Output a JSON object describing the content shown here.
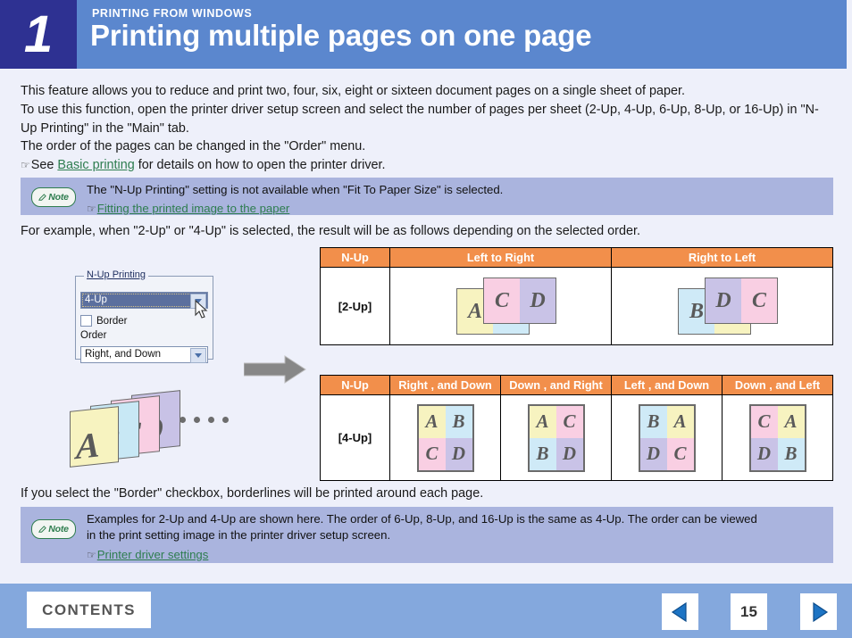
{
  "header": {
    "chapter_number": "1",
    "kicker": "PRINTING FROM WINDOWS",
    "title": "Printing multiple pages on one page",
    "number_bg": "#2e3192",
    "band_bg": "#5b87ce"
  },
  "intro": {
    "line1": "This feature allows you to reduce and print two, four, six, eight or sixteen document pages on a single sheet of paper.",
    "line2": "To use this function, open the printer driver setup screen and select the number of pages per sheet (2-Up, 4-Up, 6-Up, 8-Up, or 16-Up) in \"N-Up Printing\" in the \"Main\" tab.",
    "line3": "The order of the pages can be changed in the \"Order\" menu.",
    "line4_prefix": "See ",
    "line4_link": "Basic printing",
    "line4_suffix": " for details on how to open the printer driver."
  },
  "note_top": {
    "icon_label": "Note",
    "text": "The \"N-Up Printing\" setting is not available when \"Fit To Paper Size\" is selected.",
    "link": "Fitting the printed image to the paper",
    "bg": "#aab4de"
  },
  "example_line": "For example, when \"2-Up\" or \"4-Up\" is selected, the result will be as follows depending on the selected order.",
  "border_line": "If you select the \"Border\" checkbox, borderlines will be printed around each page.",
  "driver_dialog": {
    "group_label": "N-Up Printing",
    "nup_value": "4-Up",
    "border_checkbox_label": "Border",
    "border_checked": false,
    "order_label": "Order",
    "order_value": "Right, and Down",
    "selection_bg": "#5b6f9e"
  },
  "stack": {
    "sheets": [
      {
        "letter": "A",
        "color": "#f7f3c0"
      },
      {
        "letter": "B",
        "color": "#c8e8f5"
      },
      {
        "letter": "C",
        "color": "#f9cfe3"
      },
      {
        "letter": "D",
        "color": "#c8c2e6"
      }
    ],
    "ellipsis_dots": 4
  },
  "page_colors": {
    "A": "#f7f3c0",
    "B": "#cfeaf7",
    "C": "#f9cfe3",
    "D": "#c9c3e7"
  },
  "table_2up": {
    "header_bg": "#f28f4b",
    "headers": [
      "N-Up",
      "Left to Right",
      "Right to Left"
    ],
    "row_label": "[2-Up]",
    "cells": [
      {
        "order": "Left to Right",
        "back_sheet": [
          "A",
          "B"
        ],
        "front_sheet": [
          "C",
          "D"
        ]
      },
      {
        "order": "Right to Left",
        "back_sheet": [
          "B",
          "A"
        ],
        "front_sheet": [
          "D",
          "C"
        ]
      }
    ]
  },
  "table_4up": {
    "header_bg": "#f28f4b",
    "headers": [
      "N-Up",
      "Right , and Down",
      "Down , and Right",
      "Left , and Down",
      "Down , and Left"
    ],
    "row_label": "[4-Up]",
    "cells": [
      {
        "order": "Right , and Down",
        "quadrants": [
          "A",
          "B",
          "C",
          "D"
        ]
      },
      {
        "order": "Down , and Right",
        "quadrants": [
          "A",
          "C",
          "B",
          "D"
        ]
      },
      {
        "order": "Left , and Down",
        "quadrants": [
          "B",
          "A",
          "D",
          "C"
        ]
      },
      {
        "order": "Down , and Left",
        "quadrants": [
          "C",
          "A",
          "D",
          "B"
        ]
      }
    ]
  },
  "note_bottom": {
    "icon_label": "Note",
    "text_line1": "Examples for 2-Up and 4-Up are shown here. The order of 6-Up, 8-Up, and 16-Up is the same as 4-Up. The order can be viewed",
    "text_line2": "in the print setting image in the printer driver setup screen.",
    "link": "Printer driver settings",
    "bg": "#aab4de"
  },
  "footer": {
    "contents_label": "CONTENTS",
    "page_number": "15",
    "bg": "#84a8dd",
    "prev_icon": "triangle-left-icon",
    "next_icon": "triangle-right-icon"
  }
}
